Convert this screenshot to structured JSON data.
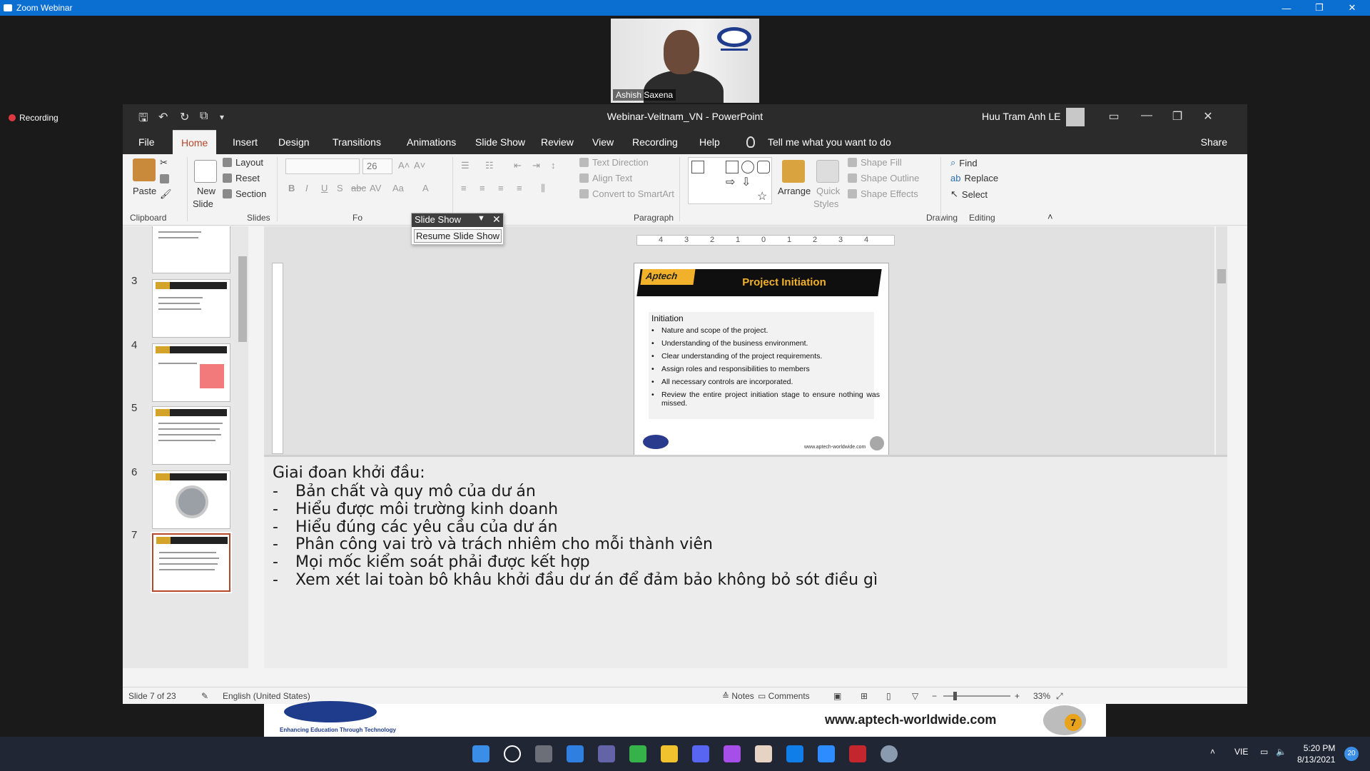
{
  "zoom": {
    "window_title": "Zoom Webinar",
    "recording_label": "Recording",
    "speaker_name": "Ashish Saxena"
  },
  "ppt": {
    "title": "Webinar-Veitnam_VN  -  PowerPoint",
    "user": "Huu Tram Anh LE",
    "tabs": [
      "File",
      "Home",
      "Insert",
      "Design",
      "Transitions",
      "Animations",
      "Slide Show",
      "Review",
      "View",
      "Recording",
      "Help"
    ],
    "active_tab": "Home",
    "tell_me": "Tell me what you want to do",
    "share": "Share",
    "ribbon": {
      "clipboard": {
        "label": "Clipboard",
        "paste": "Paste"
      },
      "slides": {
        "label": "Slides",
        "new_slide_1": "New",
        "new_slide_2": "Slide",
        "layout": "Layout",
        "reset": "Reset",
        "section": "Section"
      },
      "font": {
        "label": "Fo",
        "font_size": "26"
      },
      "paragraph": {
        "label": "Paragraph",
        "text_direction": "Text Direction",
        "align_text": "Align Text",
        "convert_smartart": "Convert to SmartArt"
      },
      "drawing": {
        "label": "Drawing",
        "arrange": "Arrange",
        "quick_1": "Quick",
        "quick_2": "Styles",
        "shape_fill": "Shape Fill",
        "shape_outline": "Shape Outline",
        "shape_effects": "Shape Effects"
      },
      "editing": {
        "label": "Editing",
        "find": "Find",
        "replace": "Replace",
        "select": "Select"
      }
    },
    "slideshow_popup": {
      "title": "Slide Show",
      "resume": "Resume Slide Show"
    },
    "thumbnails": [
      {
        "num": "3"
      },
      {
        "num": "4"
      },
      {
        "num": "5"
      },
      {
        "num": "6"
      },
      {
        "num": "7"
      }
    ],
    "ruler_ticks": [
      "4",
      "3",
      "2",
      "1",
      "0",
      "1",
      "2",
      "3",
      "4"
    ],
    "slide": {
      "badge": "Aptech",
      "title": "Project Initiation",
      "heading": "Initiation",
      "bullets": [
        "Nature and scope of the project.",
        "Understanding of the business environment.",
        "Clear understanding of the project requirements.",
        "Assign roles and responsibilities to members",
        "All necessary controls are incorporated.",
        "Review  the  entire  project  initiation  stage  to  ensure nothing was missed."
      ],
      "footer_url": "www.aptech-worldwide.com"
    },
    "notes": {
      "heading": "Giai đoan khởi đầu:",
      "items": [
        "Bản chất và quy mô của dư án",
        "Hiểu được môi trường kinh doanh",
        "Hiểu đúng các yêu cầu của dư án",
        "Phân công vai trò và trách nhiêm cho mỗi thành viên",
        "Mọi mốc kiểm soát phải được kết hợp",
        "Xem xét lai toàn bô khâu khởi đầu dư án để đảm bảo không bỏ sót điều gì"
      ]
    },
    "status": {
      "slide_of": "Slide 7 of 23",
      "language": "English (United States)",
      "notes": "Notes",
      "comments": "Comments",
      "zoom": "33%"
    }
  },
  "banner": {
    "tagline": "Enhancing Education Through Technology",
    "url": "www.aptech-worldwide.com",
    "page_num": "7"
  },
  "taskbar": {
    "lang": "VIE",
    "time": "5:20 PM",
    "date": "8/13/2021",
    "notif_count": "20"
  }
}
